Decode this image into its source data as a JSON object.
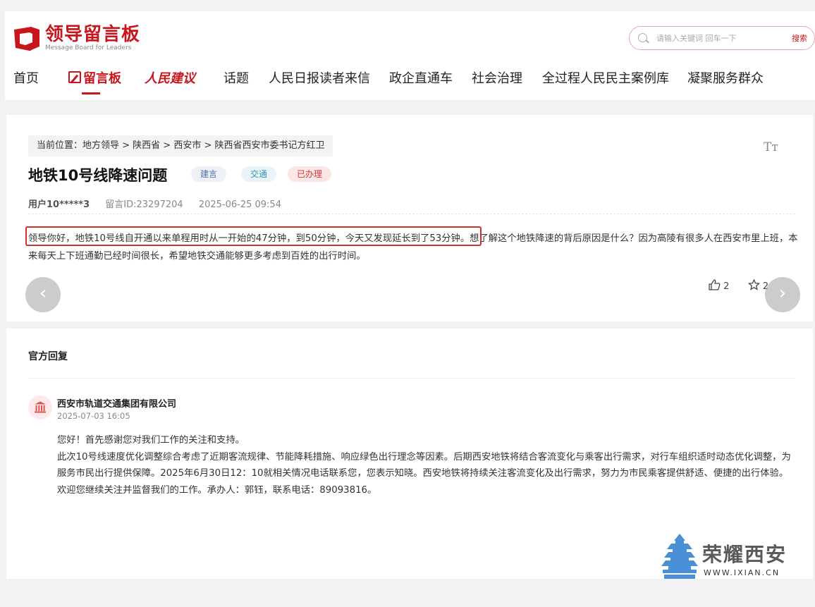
{
  "header": {
    "logo_title": "领导留言板",
    "logo_sub": "Message Board for Leaders",
    "search_placeholder": "请输入关键词 回车一下",
    "search_button": "搜索"
  },
  "nav": [
    {
      "label": "首页"
    },
    {
      "label": "留言板"
    },
    {
      "label": "人民建议"
    },
    {
      "label": "话题"
    },
    {
      "label": "人民日报读者来信"
    },
    {
      "label": "政企直通车"
    },
    {
      "label": "社会治理"
    },
    {
      "label": "全过程人民民主案例库"
    },
    {
      "label": "凝聚服务群众"
    }
  ],
  "message": {
    "breadcrumb": "当前位置：地方领导 > 陕西省 > 西安市 > 陕西省西安市委书记方红卫",
    "font_size_toggle": "Tт",
    "title": "地铁10号线降速问题",
    "tags": [
      "建言",
      "交通",
      "已办理"
    ],
    "user": "用户10*****3",
    "message_id": "留言ID:23297204",
    "datetime": "2025-06-25 09:54",
    "body": "领导你好，地铁10号线自开通以来单程用时从一开始的47分钟，到50分钟，今天又发现延长到了53分钟。想了解这个地铁降速的背后原因是什么？因为高陵有很多人在西安市里上班，本来每天上下班通勤已经时间很长，希望地铁交通能够更多考虑到百姓的出行时间。",
    "likes": "2",
    "favorites": "2",
    "prev_arrow": "‹",
    "next_arrow": "›"
  },
  "reply": {
    "heading": "官方回复",
    "org": "西安市轨道交通集团有限公司",
    "datetime": "2025-07-03 16:05",
    "paragraphs": [
      "您好！首先感谢您对我们工作的关注和支持。",
      "此次10号线速度优化调整综合考虑了近期客流规律、节能降耗措施、响应绿色出行理念等因素。后期西安地铁将结合客流变化与乘客出行需求，对行车组织适时动态优化调整，为服务市民出行提供保障。2025年6月30日12：10就相关情况电话联系您，您表示知晓。西安地铁将持续关注客流变化及出行需求，努力为市民乘客提供舒适、便捷的出行体验。",
      "欢迎您继续关注并监督我们的工作。承办人：郭钰，联系电话：89093816。"
    ]
  },
  "watermark": {
    "text": "荣耀西安",
    "url": "WWW.IXIAN.CN"
  },
  "colors": {
    "brand_red": "#c8161d",
    "highlight_border": "#d62d2d",
    "page_bg": "#f2f2f4"
  }
}
